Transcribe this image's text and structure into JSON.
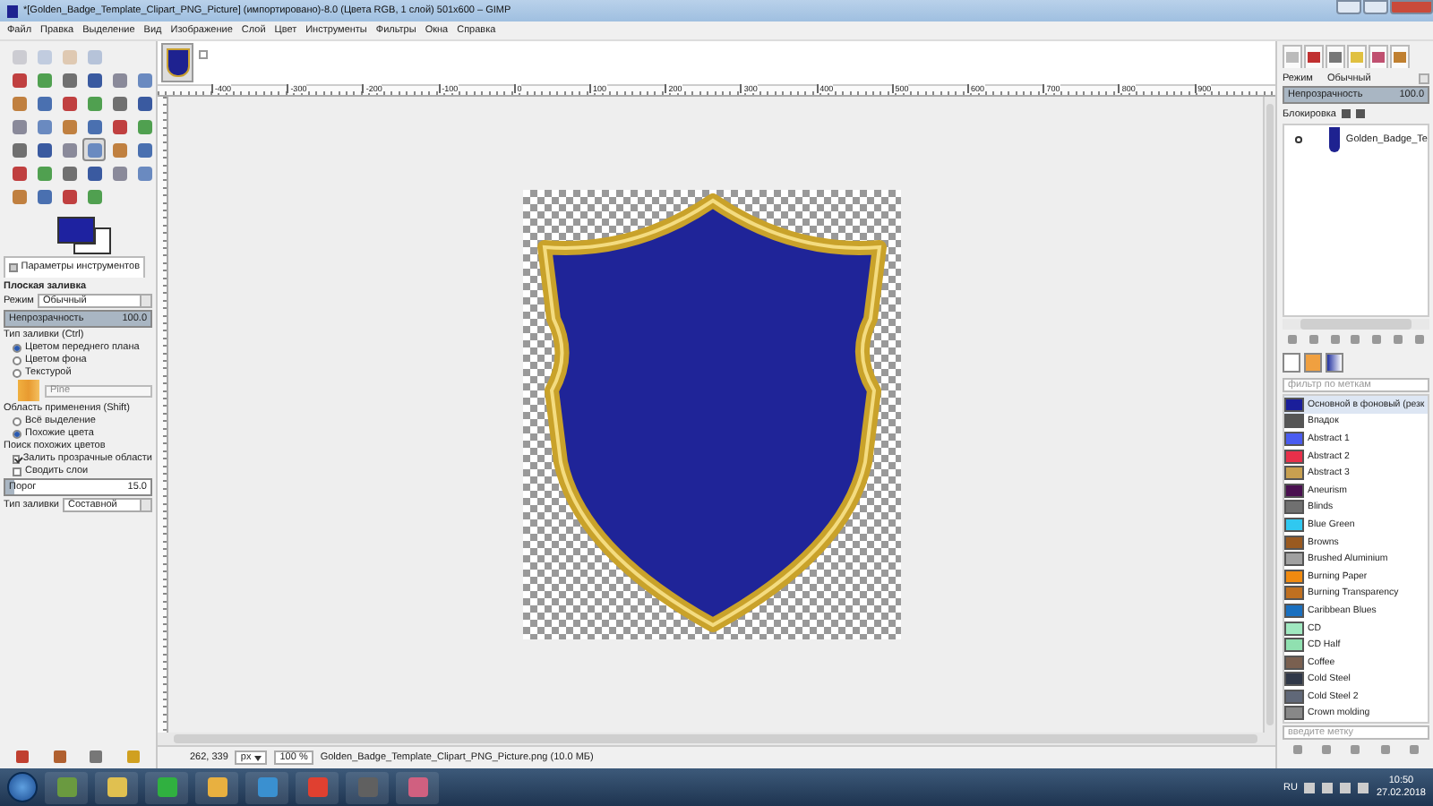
{
  "window": {
    "title": "*[Golden_Badge_Template_Clipart_PNG_Picture] (импортировано)-8.0 (Цвета RGB, 1 слой) 501x600 – GIMP"
  },
  "menu": [
    "Файл",
    "Правка",
    "Выделение",
    "Вид",
    "Изображение",
    "Слой",
    "Цвет",
    "Инструменты",
    "Фильтры",
    "Окна",
    "Справка"
  ],
  "toolbox": {
    "tools": [
      {
        "selected": false
      },
      {
        "selected": false
      },
      {
        "selected": false
      },
      {
        "selected": false
      },
      {
        "selected": false
      },
      {
        "selected": false
      },
      {
        "selected": false
      },
      {
        "selected": false
      },
      {
        "selected": false
      },
      {
        "selected": false
      },
      {
        "selected": false
      },
      {
        "selected": false
      },
      {
        "selected": false
      },
      {
        "selected": false
      },
      {
        "selected": false
      },
      {
        "selected": false
      },
      {
        "selected": false
      },
      {
        "selected": false
      },
      {
        "selected": false
      },
      {
        "selected": false
      },
      {
        "selected": false
      },
      {
        "selected": false
      },
      {
        "selected": false
      },
      {
        "selected": false
      },
      {
        "selected": false
      },
      {
        "selected": true
      },
      {
        "selected": false
      },
      {
        "selected": false
      },
      {
        "selected": false
      },
      {
        "selected": false
      },
      {
        "selected": false
      },
      {
        "selected": false
      },
      {
        "selected": false
      },
      {
        "selected": false
      },
      {
        "selected": false
      },
      {
        "selected": false
      },
      {
        "selected": false
      },
      {
        "selected": false
      }
    ]
  },
  "tool_options": {
    "tab": "Параметры инструментов",
    "title": "Плоская заливка",
    "mode": {
      "label": "Режим",
      "value": "Обычный"
    },
    "opacity": {
      "label": "Непрозрачность",
      "value": "100.0",
      "level": 1
    },
    "fill_type_label": "Тип заливки (Ctrl)",
    "fill_types": [
      {
        "label": "Цветом переднего плана",
        "selected": true
      },
      {
        "label": "Цветом фона",
        "selected": false
      },
      {
        "label": "Текстурой",
        "selected": false
      }
    ],
    "pattern": "Pine",
    "area_label": "Область применения (Shift)",
    "areas": [
      {
        "label": "Всё выделение",
        "selected": false
      },
      {
        "label": "Похожие цвета",
        "selected": true
      }
    ],
    "similar_label": "Поиск похожих цветов",
    "checks": [
      {
        "label": "Залить прозрачные области",
        "checked": true
      },
      {
        "label": "Сводить слои",
        "checked": false
      }
    ],
    "threshold": {
      "label": "Порог",
      "value": "15.0",
      "level": 0.06
    },
    "fill_by": {
      "label": "Тип заливки",
      "value": "Составной"
    }
  },
  "canvas": {
    "ruler_labels": [
      "-400",
      "-300",
      "-200",
      "-100",
      "0",
      "100",
      "200",
      "300",
      "400",
      "500",
      "600",
      "700",
      "800",
      "900"
    ]
  },
  "status_bar": {
    "coords": "262, 339",
    "unit": "px",
    "zoom": "100 %",
    "file": "Golden_Badge_Template_Clipart_PNG_Picture.png (10.0 МБ)"
  },
  "layers": {
    "mode": {
      "label": "Режим",
      "value": "Обычный"
    },
    "opacity": {
      "label": "Непрозрачность",
      "value": "100.0",
      "level": 1
    },
    "lock_label": "Блокировка",
    "items": [
      {
        "name": "Golden_Badge_Te",
        "visible": true
      }
    ]
  },
  "gradients": {
    "filter_placeholder": "фильтр по меткам",
    "tag_placeholder": "введите метку",
    "items": [
      {
        "name": "Основной в фоновый (резк",
        "color": "#1a1e9a",
        "selected": true
      },
      {
        "name": "Впадок",
        "color": "#555555",
        "selected": false
      },
      {
        "name": "Abstract 1",
        "color": "#4a5cf0",
        "selected": false
      },
      {
        "name": "Abstract 2",
        "color": "#e8304a",
        "selected": false
      },
      {
        "name": "Abstract 3",
        "color": "#c8a050",
        "selected": false
      },
      {
        "name": "Aneurism",
        "color": "#4a1050",
        "selected": false
      },
      {
        "name": "Blinds",
        "color": "#707070",
        "selected": false
      },
      {
        "name": "Blue Green",
        "color": "#30c8f0",
        "selected": false
      },
      {
        "name": "Browns",
        "color": "#9a5a20",
        "selected": false
      },
      {
        "name": "Brushed Aluminium",
        "color": "#a0a0a0",
        "selected": false
      },
      {
        "name": "Burning Paper",
        "color": "#f08a10",
        "selected": false
      },
      {
        "name": "Burning Transparency",
        "color": "#c07020",
        "selected": false
      },
      {
        "name": "Caribbean Blues",
        "color": "#1a70c0",
        "selected": false
      },
      {
        "name": "CD",
        "color": "#a0e8c0",
        "selected": false
      },
      {
        "name": "CD Half",
        "color": "#90e0b0",
        "selected": false
      },
      {
        "name": "Coffee",
        "color": "#7a6050",
        "selected": false
      },
      {
        "name": "Cold Steel",
        "color": "#303848",
        "selected": false
      },
      {
        "name": "Cold Steel 2",
        "color": "#606878",
        "selected": false
      },
      {
        "name": "Crown molding",
        "color": "#888888",
        "selected": false
      }
    ]
  },
  "taskbar": {
    "language": "RU",
    "time": "10:50",
    "date": "27.02.2018"
  }
}
